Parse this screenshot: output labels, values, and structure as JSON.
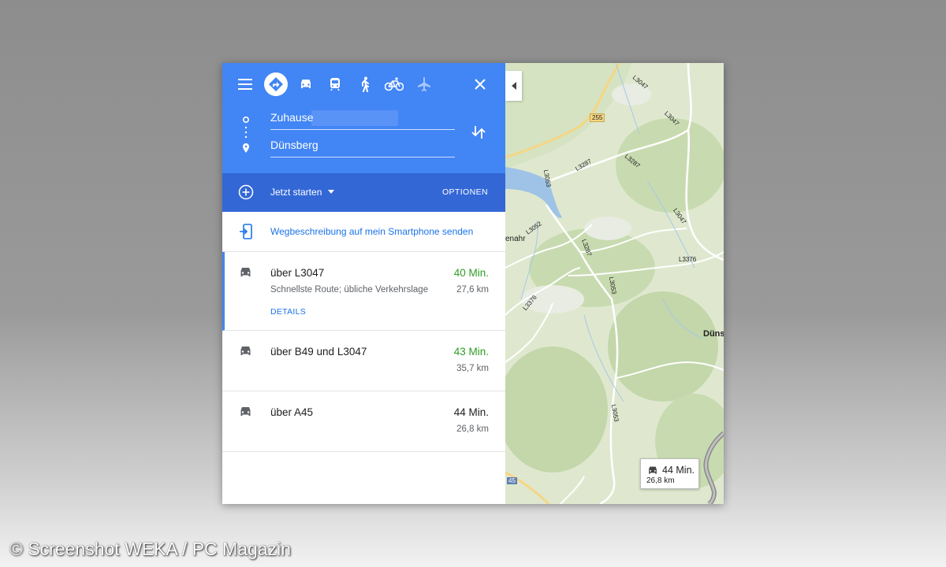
{
  "header": {
    "modes": [
      "menu-icon",
      "directions-icon",
      "car-icon",
      "train-icon",
      "walk-icon",
      "bicycle-icon",
      "flight-icon"
    ],
    "origin_value": "Zuhause",
    "destination_value": "Dünsberg"
  },
  "options_bar": {
    "start_label": "Jetzt starten",
    "options_label": "OPTIONEN"
  },
  "send_to_phone": "Wegbeschreibung auf mein Smartphone senden",
  "routes": [
    {
      "name": "über L3047",
      "subtitle": "Schnellste Route; übliche Verkehrslage",
      "details": "DETAILS",
      "time": "40 Min.",
      "distance": "27,6 km"
    },
    {
      "name": "über B49 und L3047",
      "time": "43 Min.",
      "distance": "35,7 km"
    },
    {
      "name": "über A45",
      "time": "44 Min.",
      "distance": "26,8 km"
    }
  ],
  "map": {
    "road_labels": [
      "L3047",
      "255",
      "L3047",
      "L3287",
      "L3287",
      "L3053",
      "L3052",
      "L3047",
      "L3376",
      "L3287",
      "L3053",
      "L3376",
      "L3053",
      "45"
    ],
    "place_partial_left": "enahr",
    "place_partial_right": "Düns",
    "bubble_time": "44 Min.",
    "bubble_distance": "26,8 km"
  },
  "credit": "© Screenshot WEKA / PC Magazin",
  "colors": {
    "header_blue": "#4285f4",
    "bar_blue": "#3367d6",
    "green": "#2e9e23",
    "link_blue": "#1a73e8"
  }
}
